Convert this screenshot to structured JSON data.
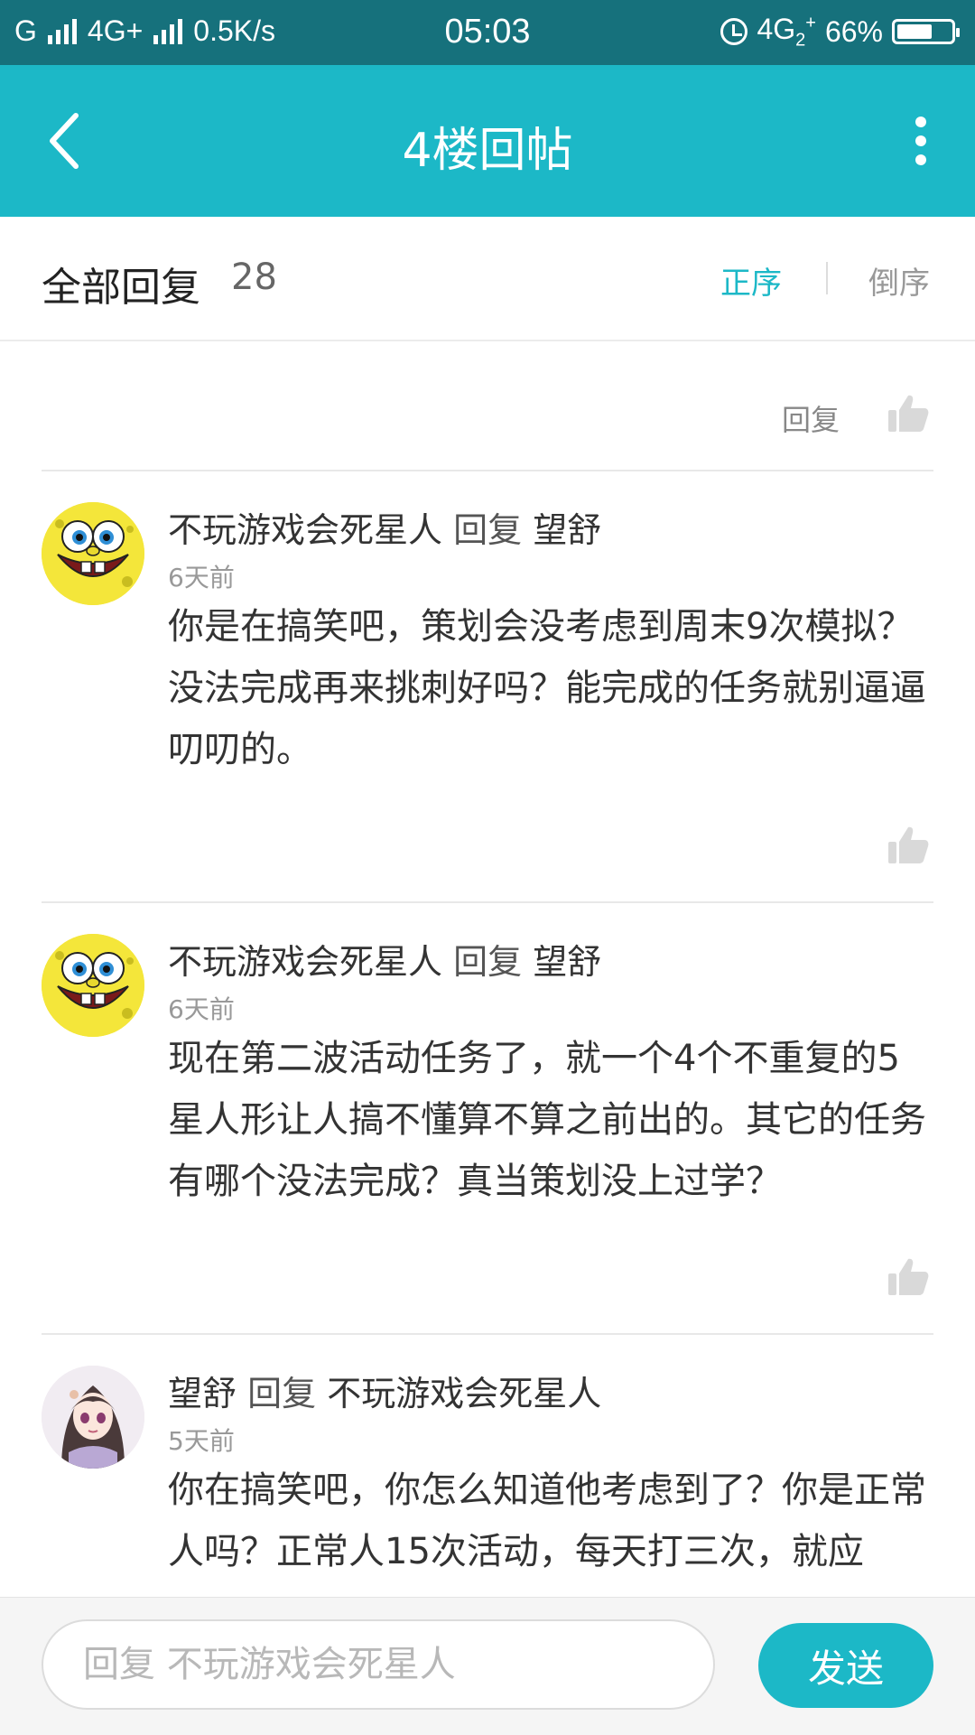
{
  "status_bar": {
    "carrier_1": "G",
    "carrier_2": "4G+",
    "speed": "0.5K/s",
    "time": "05:03",
    "network_right": "4G",
    "battery_percent": "66%",
    "battery_level": 0.66
  },
  "navbar": {
    "title": "4楼回帖",
    "back_icon": "chevron-left-icon",
    "more_icon": "more-vertical-icon"
  },
  "replies_header": {
    "title": "全部回复",
    "count": "28",
    "sort_asc_label": "正序",
    "sort_desc_label": "倒序"
  },
  "previous_reply_tail": {
    "reply_label": "回复"
  },
  "replies": [
    {
      "author": "不玩游戏会死星人",
      "reply_word": "回复",
      "target": "望舒",
      "time": "6天前",
      "body": "你是在搞笑吧，策划会没考虑到周末9次模拟？没法完成再来挑刺好吗？能完成的任务就别逼逼叨叨的。",
      "avatar": "spongebob-avatar"
    },
    {
      "author": "不玩游戏会死星人",
      "reply_word": "回复",
      "target": "望舒",
      "time": "6天前",
      "body": "现在第二波活动任务了，就一个4个不重复的5星人形让人搞不懂算不算之前出的。其它的任务有哪个没法完成？真当策划没上过学？",
      "avatar": "spongebob-avatar"
    },
    {
      "author": "望舒",
      "reply_word": "回复",
      "target": "不玩游戏会死星人",
      "time": "5天前",
      "body": "你在搞笑吧，你怎么知道他考虑到了？你是正常人吗？正常人15次活动，每天打三次，就应",
      "avatar": "anime-girl-avatar"
    }
  ],
  "input_bar": {
    "placeholder": "回复 不玩游戏会死星人",
    "send_label": "发送"
  },
  "colors": {
    "status_bar": "#16717c",
    "navbar": "#1cb8c7",
    "accent": "#1cb8c7"
  }
}
